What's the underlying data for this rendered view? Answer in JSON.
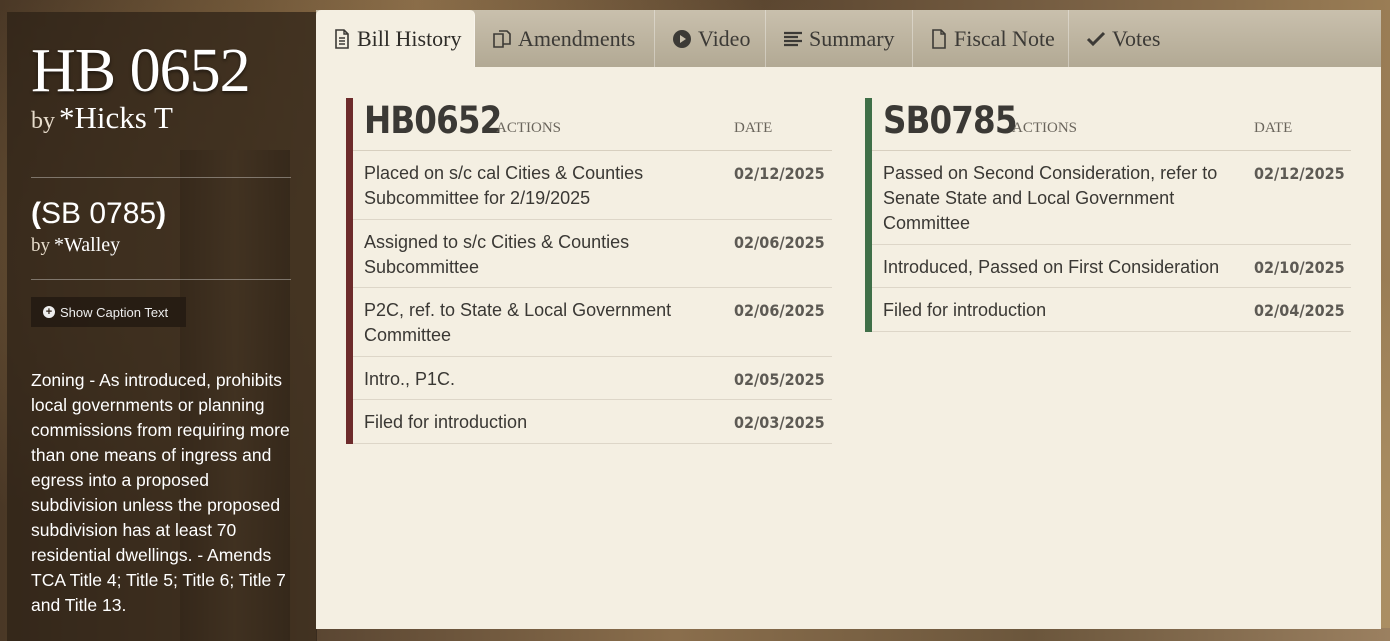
{
  "sidebar": {
    "bill_number": "HB 0652",
    "sponsor_prefix": "by",
    "sponsor": "*Hicks T",
    "companion_open": "(",
    "companion_number": "SB 0785",
    "companion_close": ")",
    "companion_sponsor_prefix": "by",
    "companion_sponsor": "*Walley",
    "caption_button": "Show Caption Text",
    "summary": "Zoning - As introduced, prohibits local governments or planning commissions from requiring more than one means of ingress and egress into a proposed subdivision unless the proposed subdivision has at least 70 residential dwellings. - Amends TCA Title 4; Title 5; Title 6; Title 7 and Title 13."
  },
  "tabs": [
    {
      "label": "Bill History",
      "icon": "document-icon",
      "active": true
    },
    {
      "label": "Amendments",
      "icon": "copy-icon",
      "active": false
    },
    {
      "label": "Video",
      "icon": "play-icon",
      "active": false
    },
    {
      "label": "Summary",
      "icon": "lines-icon",
      "active": false
    },
    {
      "label": "Fiscal Note",
      "icon": "blank-document-icon",
      "active": false
    },
    {
      "label": "Votes",
      "icon": "check-icon",
      "active": false
    }
  ],
  "house": {
    "number": "HB0652",
    "actions_label": "ACTIONS",
    "date_label": "DATE",
    "accent": "#6d2b2b",
    "rows": [
      {
        "action": "Placed on s/c cal Cities & Counties Subcommittee for 2/19/2025",
        "date": "02/12/2025"
      },
      {
        "action": "Assigned to s/c Cities & Counties Subcommittee",
        "date": "02/06/2025"
      },
      {
        "action": "P2C, ref. to State & Local Government Committee",
        "date": "02/06/2025"
      },
      {
        "action": "Intro., P1C.",
        "date": "02/05/2025"
      },
      {
        "action": "Filed for introduction",
        "date": "02/03/2025"
      }
    ]
  },
  "senate": {
    "number": "SB0785",
    "actions_label": "ACTIONS",
    "date_label": "DATE",
    "accent": "#3f6f48",
    "rows": [
      {
        "action": "Passed on Second Consideration, refer to Senate State and Local Government Committee",
        "date": "02/12/2025"
      },
      {
        "action": "Introduced, Passed on First Consideration",
        "date": "02/10/2025"
      },
      {
        "action": "Filed for introduction",
        "date": "02/04/2025"
      }
    ]
  }
}
